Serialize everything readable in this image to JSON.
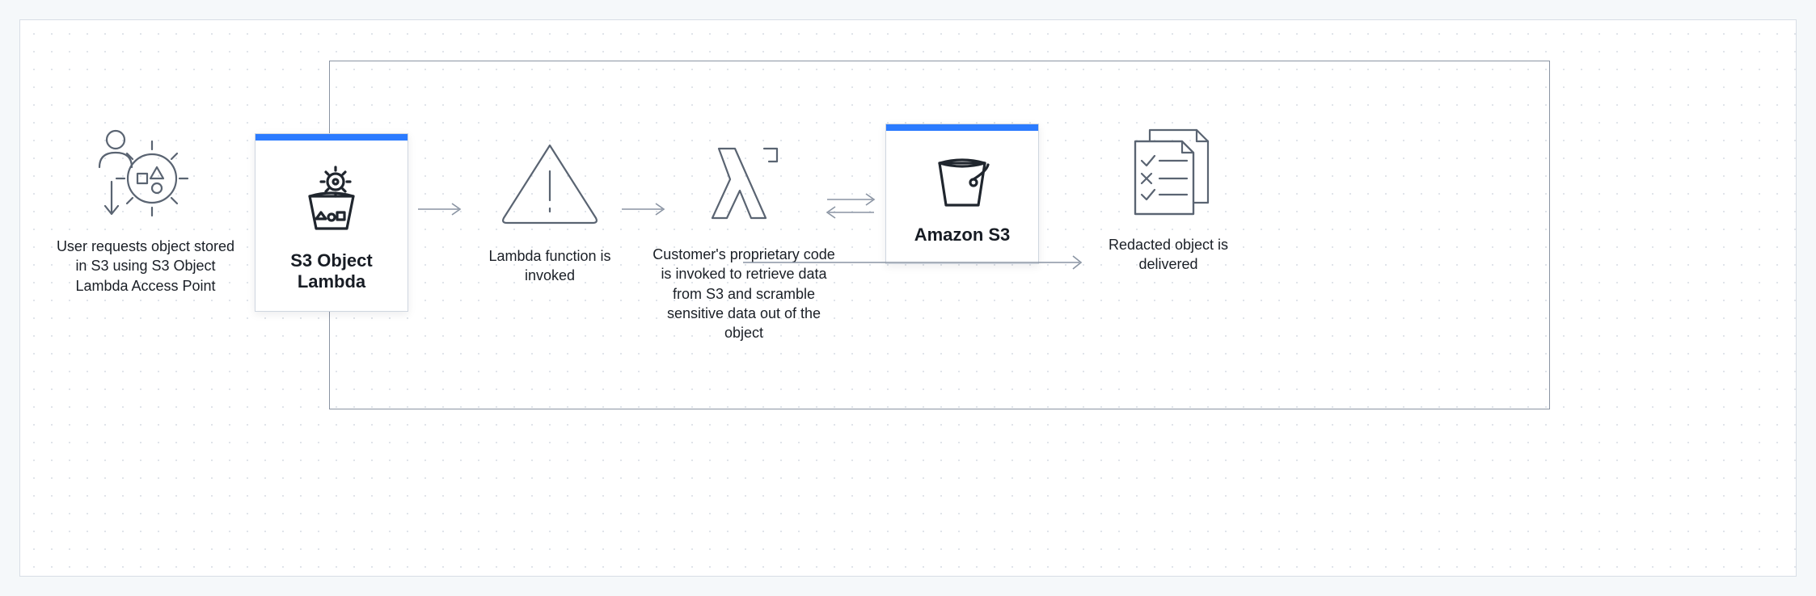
{
  "nodes": {
    "user_request": {
      "caption": "User requests object stored in S3 using S3 Object Lambda Access Point"
    },
    "s3_object_lambda": {
      "title": "S3 Object\nLambda"
    },
    "lambda_invoked": {
      "caption": "Lambda function is invoked"
    },
    "customer_code": {
      "caption": "Customer's proprietary code is invoked to retrieve data from S3 and scramble sensitive data out of the object"
    },
    "amazon_s3": {
      "title": "Amazon S3"
    },
    "redacted": {
      "caption": "Redacted object is delivered"
    }
  },
  "colors": {
    "accent": "#2b7bff",
    "stroke": "#8a94a3",
    "icon": "#5a6472",
    "icon_dark": "#20262e"
  }
}
